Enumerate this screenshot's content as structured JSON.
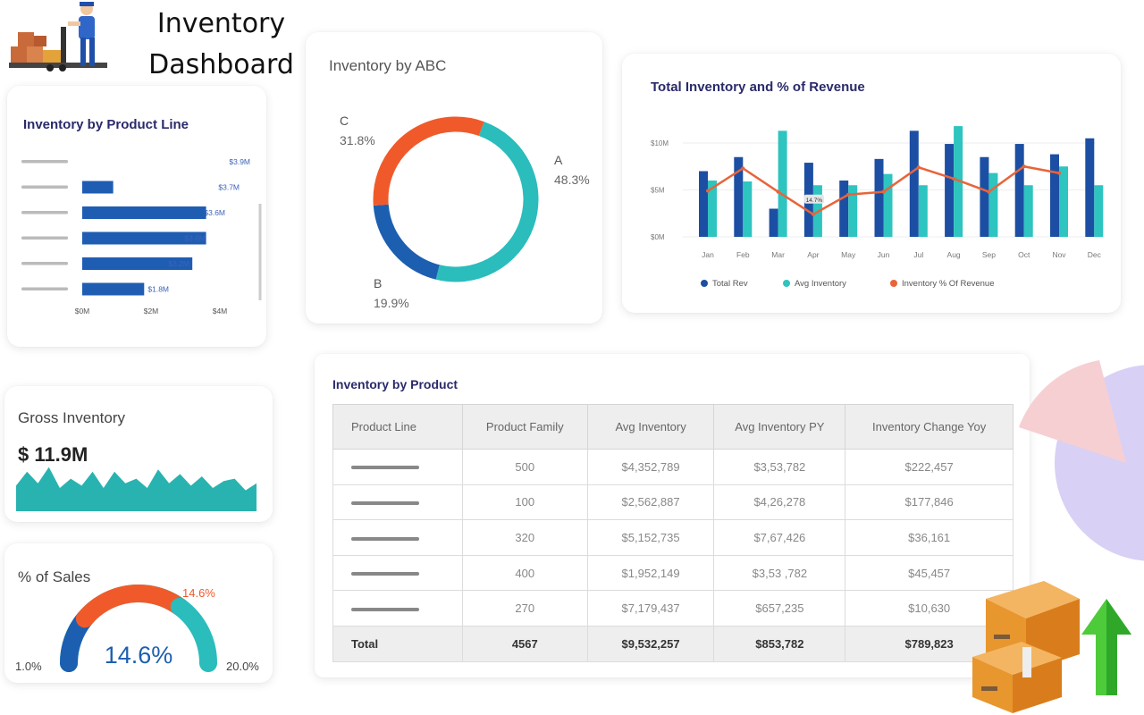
{
  "header": {
    "title_line1": "Inventory",
    "title_line2": "Dashboard",
    "logo_icon": "warehouse-worker-icon"
  },
  "product_line": {
    "title": "Inventory by Product Line",
    "chart_data": {
      "type": "bar",
      "orientation": "horizontal",
      "values": [
        3.9,
        0.9,
        3.6,
        3.6,
        3.2,
        1.8
      ],
      "value_labels": [
        "$3.9M",
        "$3.7M",
        "$3.6M",
        "$3.6M",
        "$3.2M",
        "$1.8M"
      ],
      "x_ticks": [
        "$0M",
        "$2M",
        "$4M"
      ],
      "xlim": [
        0,
        4
      ],
      "color": "#1f5db3"
    }
  },
  "abc": {
    "title": "Inventory by ABC",
    "chart_data": {
      "type": "pie",
      "donut": true,
      "slices": [
        {
          "label": "A",
          "value": 48.3,
          "text": "48.3%",
          "color": "#2bbcbc"
        },
        {
          "label": "B",
          "value": 19.9,
          "text": "19.9%",
          "color": "#1c5fb0"
        },
        {
          "label": "C",
          "value": 31.8,
          "text": "31.8%",
          "color": "#f05a2a"
        }
      ]
    }
  },
  "revenue": {
    "title": "Total Inventory and % of Revenue",
    "chart_data": {
      "type": "bar",
      "categories": [
        "Jan",
        "Feb",
        "Mar",
        "Apr",
        "May",
        "Jun",
        "Jul",
        "Aug",
        "Sep",
        "Oct",
        "Nov",
        "Dec"
      ],
      "y_ticks": [
        "$0M",
        "$5M",
        "$10M"
      ],
      "ylim": [
        0,
        12
      ],
      "series": [
        {
          "name": "Total Rev",
          "type": "bar",
          "color": "#1c4fa3",
          "values": [
            7,
            8.5,
            3,
            7.9,
            6,
            8.3,
            11.3,
            9.9,
            8.5,
            9.9,
            8.8,
            10.5
          ]
        },
        {
          "name": "Avg Inventory",
          "type": "bar",
          "color": "#2ec4c0",
          "values": [
            6,
            5.9,
            11.3,
            5.5,
            5.5,
            6.7,
            5.5,
            11.8,
            6.8,
            5.5,
            7.5,
            5.5
          ]
        },
        {
          "name": "Inventory % Of Revenue",
          "type": "line",
          "color": "#e8643a",
          "values": [
            4.9,
            7.3,
            4.8,
            2.4,
            4.5,
            4.8,
            7.4,
            6.2,
            4.8,
            7.5,
            6.8
          ]
        }
      ],
      "point_label": "14.7%",
      "legend_position": "bottom"
    }
  },
  "gross": {
    "title": "Gross Inventory",
    "value": "$ 11.9M",
    "sparkline": [
      0.55,
      0.85,
      0.6,
      0.95,
      0.5,
      0.7,
      0.55,
      0.85,
      0.5,
      0.85,
      0.6,
      0.7,
      0.5,
      0.9,
      0.6,
      0.8,
      0.55,
      0.75,
      0.5,
      0.65,
      0.7,
      0.45,
      0.6
    ],
    "color": "#29b3b0"
  },
  "sales": {
    "title": "% of Sales",
    "value": "14.6%",
    "marker": "14.6%",
    "min": "1.0%",
    "max": "20.0%",
    "gauge_fraction": 0.7,
    "colors": {
      "start": "#1c5fb0",
      "mid": "#f05a2a",
      "end": "#2bbcbc"
    }
  },
  "products": {
    "title": "Inventory by Product",
    "headers": [
      "Product Line",
      "Product Family",
      "Avg Inventory",
      "Avg Inventory PY",
      "Inventory Change Yoy"
    ],
    "rows": [
      {
        "family": "500",
        "avg": "$4,352,789",
        "py": "$3,53,782",
        "chg": "$222,457"
      },
      {
        "family": "100",
        "avg": "$2,562,887",
        "py": "$4,26,278",
        "chg": "$177,846"
      },
      {
        "family": "320",
        "avg": "$5,152,735",
        "py": "$7,67,426",
        "chg": "$36,161"
      },
      {
        "family": "400",
        "avg": "$1,952,149",
        "py": "$3,53 ,782",
        "chg": "$45,457"
      },
      {
        "family": "270",
        "avg": "$7,179,437",
        "py": "$657,235",
        "chg": "$10,630"
      }
    ],
    "total": {
      "label": "Total",
      "family": "4567",
      "avg": "$9,532,257",
      "py": "$853,782",
      "chg": "$789,823"
    }
  },
  "decor": {
    "pie_icon": "pie-chart-decor-icon",
    "boxes_icon": "boxes-arrow-up-icon"
  }
}
